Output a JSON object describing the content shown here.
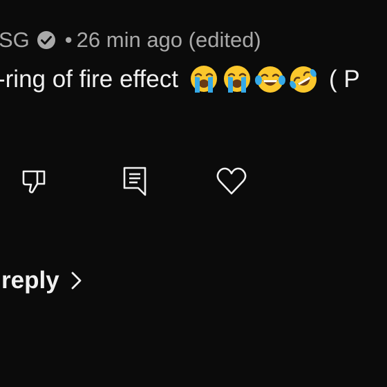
{
  "comment": {
    "author": "SG",
    "separator": "•",
    "timestamp": "26 min ago (edited)",
    "text_prefix": "- ",
    "text": "ring of fire effect",
    "emojis": [
      "loudly-crying-face",
      "loudly-crying-face",
      "face-with-tears-of-joy",
      "rolling-on-the-floor-laughing"
    ],
    "trailing_text": "( P"
  },
  "actions": {
    "dislike_icon": "thumbs-down-icon",
    "reply_icon": "comment-icon",
    "like_icon": "heart-icon"
  },
  "replies": {
    "label": "reply",
    "icon": "chevron-right-icon"
  },
  "colors": {
    "background": "#0b0b0b",
    "primary_text": "#f1f1f1",
    "secondary_text": "#a9a9a9",
    "emoji_face": "#fbc72c",
    "emoji_tears": "#35a9e8"
  }
}
